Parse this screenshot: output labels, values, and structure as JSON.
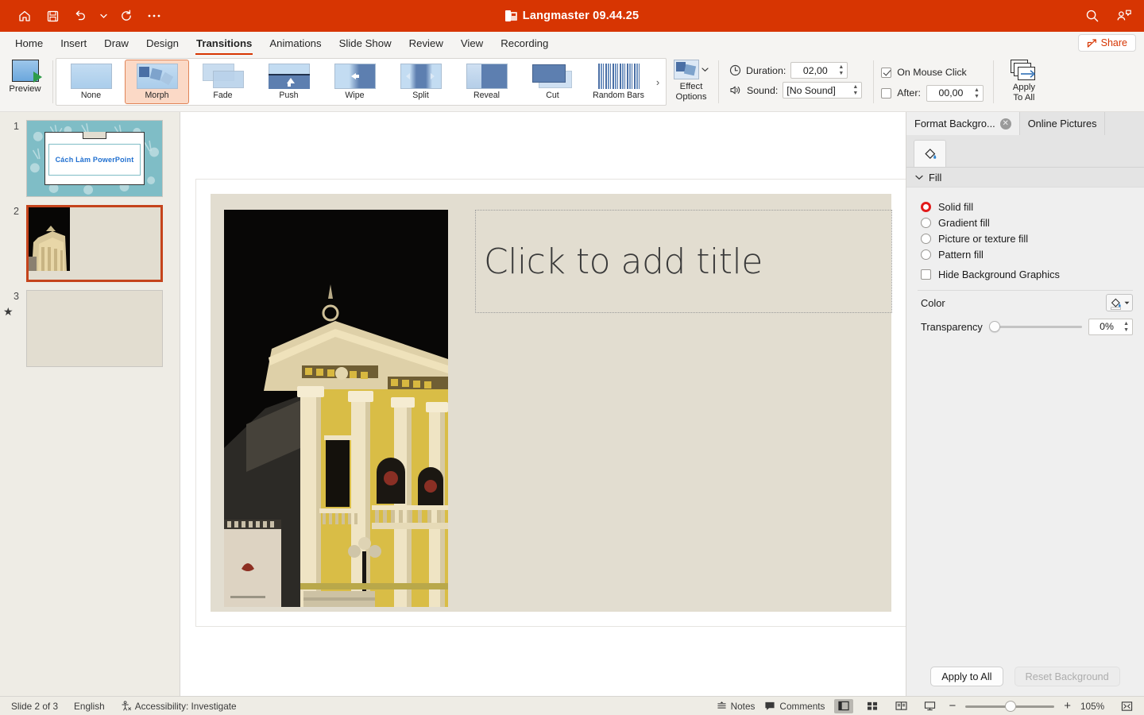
{
  "titlebar": {
    "doc_title": "Langmaster 09.44.25",
    "icons": [
      "home-icon",
      "save-icon",
      "undo-icon",
      "undo-dropdown-icon",
      "redo-icon",
      "more-icon"
    ],
    "search_icon": "search-icon",
    "collab_icon": "collaborators-icon",
    "brand_color": "#d73502"
  },
  "tabs": {
    "items": [
      {
        "label": "Home"
      },
      {
        "label": "Insert"
      },
      {
        "label": "Draw"
      },
      {
        "label": "Design"
      },
      {
        "label": "Transitions"
      },
      {
        "label": "Animations"
      },
      {
        "label": "Slide Show"
      },
      {
        "label": "Review"
      },
      {
        "label": "View"
      },
      {
        "label": "Recording"
      }
    ],
    "active": "Transitions",
    "share_label": "Share"
  },
  "ribbon": {
    "preview_label": "Preview",
    "gallery": [
      {
        "label": "None",
        "kind": "none"
      },
      {
        "label": "Morph",
        "kind": "morph"
      },
      {
        "label": "Fade",
        "kind": "fade"
      },
      {
        "label": "Push",
        "kind": "push"
      },
      {
        "label": "Wipe",
        "kind": "wipe"
      },
      {
        "label": "Split",
        "kind": "split"
      },
      {
        "label": "Reveal",
        "kind": "reveal"
      },
      {
        "label": "Cut",
        "kind": "cut"
      },
      {
        "label": "Random Bars",
        "kind": "bars"
      }
    ],
    "selected_transition": "Morph",
    "gallery_more_icon": "chevron-right-icon",
    "effect_options_label": "Effect\nOptions",
    "effect_options_line1": "Effect",
    "effect_options_line2": "Options",
    "duration_label": "Duration:",
    "duration_value": "02,00",
    "sound_label": "Sound:",
    "sound_value": "[No Sound]",
    "on_mouse_click_label": "On Mouse Click",
    "on_mouse_click_checked": true,
    "after_label": "After:",
    "after_value": "00,00",
    "after_checked": false,
    "apply_to_all_line1": "Apply",
    "apply_to_all_line2": "To All"
  },
  "thumbnails": [
    {
      "number": "1",
      "title": "Cách Làm PowerPoint",
      "selected": false,
      "kind": "title-slide"
    },
    {
      "number": "2",
      "title": "",
      "selected": true,
      "kind": "picture-slide",
      "has_transition_star": true
    },
    {
      "number": "3",
      "title": "",
      "selected": false,
      "kind": "blank-slide"
    }
  ],
  "slide": {
    "title_placeholder": "Click to add title",
    "background_color": "#e2ddd0",
    "image_alt": "opera-house-night-photo"
  },
  "panel": {
    "tab_format_background": "Format Backgro...",
    "tab_online_pictures": "Online Pictures",
    "close_icon": "close-icon",
    "fill_icon_tab": "paint-bucket-icon",
    "section_fill": "Fill",
    "fill_options": [
      {
        "label": "Solid fill",
        "selected": true
      },
      {
        "label": "Gradient fill",
        "selected": false
      },
      {
        "label": "Picture or texture fill",
        "selected": false
      },
      {
        "label": "Pattern fill",
        "selected": false
      }
    ],
    "hide_background_graphics": "Hide Background Graphics",
    "hide_background_checked": false,
    "color_label": "Color",
    "color_swatch": "#ffffff",
    "transparency_label": "Transparency",
    "transparency_value": "0%",
    "apply_to_all_label": "Apply to All",
    "reset_background_label": "Reset Background",
    "reset_disabled": true
  },
  "status": {
    "slide_count": "Slide 2 of 3",
    "language": "English",
    "accessibility": "Accessibility: Investigate",
    "notes_label": "Notes",
    "comments_label": "Comments",
    "zoom_level": "105%",
    "zoom_minus": "−",
    "zoom_plus": "+",
    "views": [
      "normal-view",
      "slide-sorter-view",
      "reading-view",
      "slideshow-view"
    ],
    "active_view": "normal-view"
  }
}
